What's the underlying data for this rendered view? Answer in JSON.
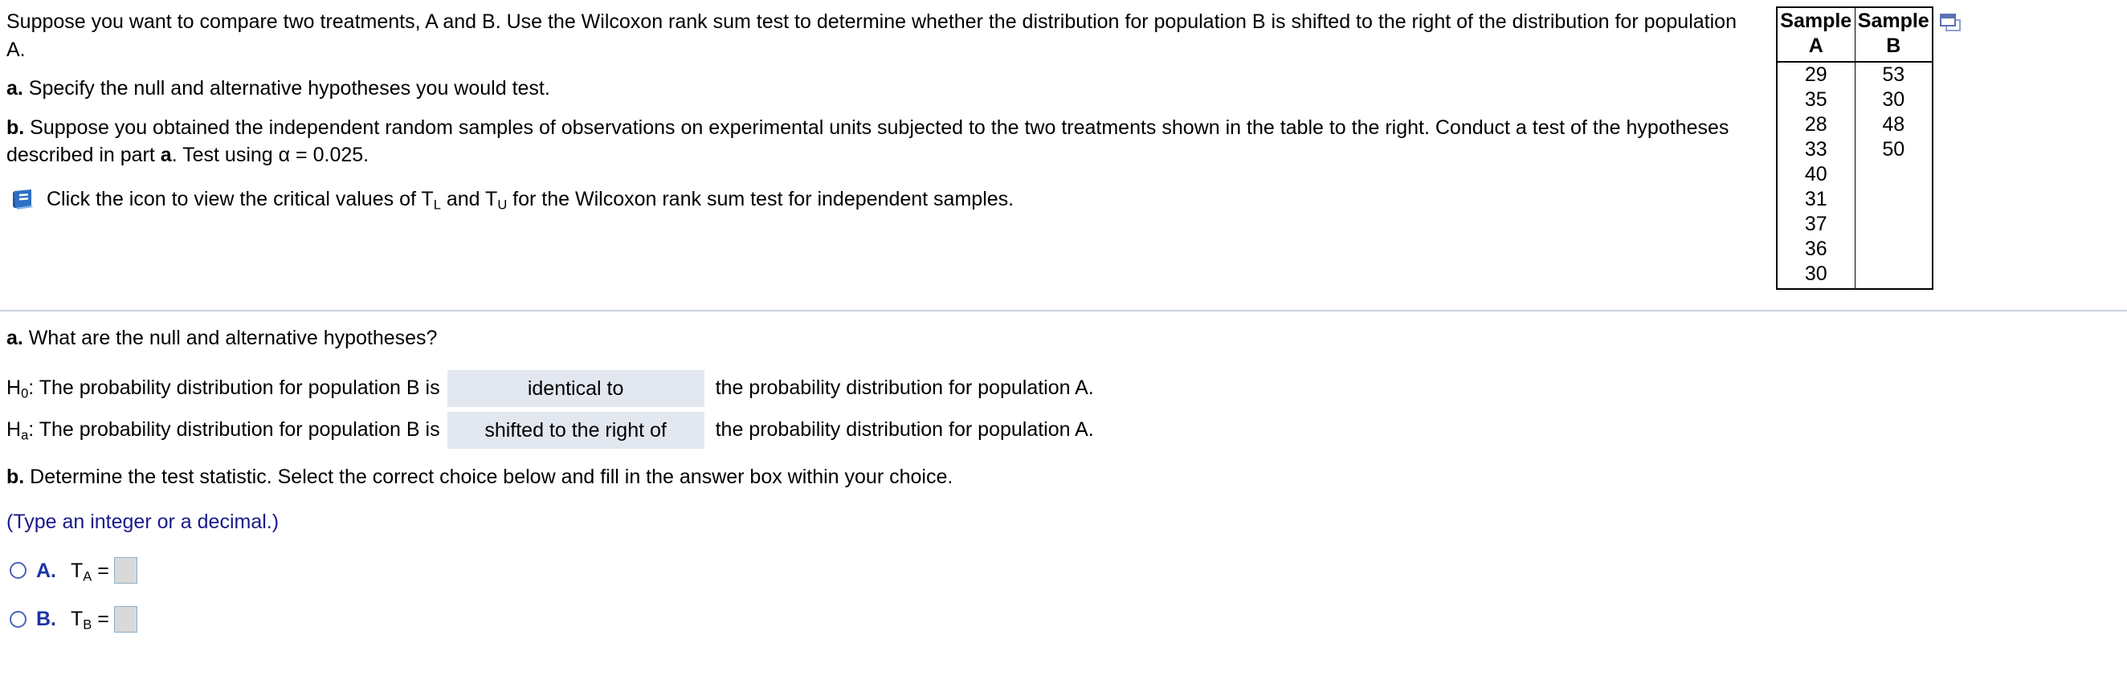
{
  "problem": {
    "intro_text": "Suppose you want to compare two treatments, A and B. Use the Wilcoxon rank sum test to determine whether the distribution for population B is shifted to the right of the distribution for population A.",
    "part_a_label": "a.",
    "part_a_text": " Specify the null and alternative hypotheses you would test.",
    "part_b_label": "b.",
    "part_b_text_1": " Suppose you obtained the independent random samples of observations on experimental units subjected to the two treatments shown in the table to the right. Conduct a test of the hypotheses described in part ",
    "part_b_bold_a": "a",
    "part_b_text_2": ". Test using ",
    "alpha_symbol": "α",
    "alpha_equals": " = ",
    "alpha_value": "0.025",
    "part_b_text_3": ".",
    "icon_line_1": "Click the icon to view the critical values of T",
    "icon_sub_1": "L",
    "icon_line_2": " and T",
    "icon_sub_2": "U",
    "icon_line_3": " for the Wilcoxon rank sum test for independent samples."
  },
  "data_table": {
    "headers": [
      {
        "line1": "Sample",
        "line2": "A"
      },
      {
        "line1": "Sample",
        "line2": "B"
      }
    ],
    "sample_a": [
      "29",
      "35",
      "28",
      "33",
      "40",
      "31",
      "37",
      "36",
      "30"
    ],
    "sample_b": [
      "53",
      "30",
      "48",
      "50",
      "",
      "",
      "",
      "",
      ""
    ]
  },
  "icons": {
    "book_icon": "book-icon",
    "popout_icon": "popout-window-icon"
  },
  "answers": {
    "question_a_label": "a.",
    "question_a_text": " What are the null and alternative hypotheses?",
    "h0_prefix": "H",
    "h0_sub": "0",
    "h0_lead": ": The probability distribution for population B is",
    "h0_selected": "identical to",
    "h0_tail": "the probability distribution for population A.",
    "ha_prefix": "H",
    "ha_sub": "a",
    "ha_lead": ": The probability distribution for population B is",
    "ha_selected": "shifted to the right of",
    "ha_tail": "the probability distribution for population A.",
    "question_b_label": "b.",
    "question_b_text": " Determine the test statistic. Select the correct choice below and fill in the answer box within your choice.",
    "type_hint": "(Type an integer or a decimal.)",
    "choices": [
      {
        "letter": "A.",
        "stat_base": "T",
        "stat_sub": "A",
        "equals": " =",
        "value": ""
      },
      {
        "letter": "B.",
        "stat_base": "T",
        "stat_sub": "B",
        "equals": " =",
        "value": ""
      }
    ]
  },
  "colors": {
    "accent_blue": "#1d35a6",
    "hint_blue": "#1a1a8c",
    "dropdown_bg": "#e2e7f0",
    "divider": "#c9d0e0",
    "answer_box_bg": "#d9d9d9",
    "book_icon_blue": "#2f6fc4",
    "popout_blue": "#6b7fbe"
  }
}
